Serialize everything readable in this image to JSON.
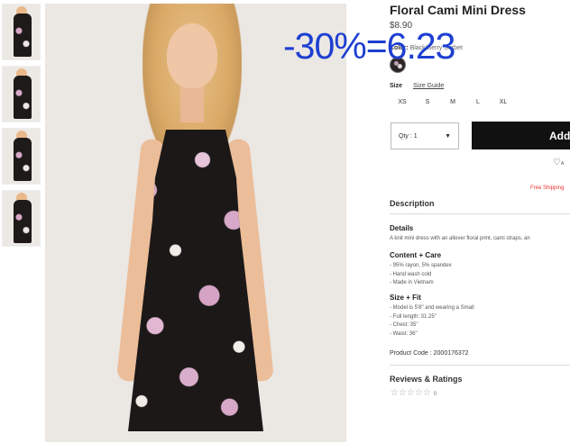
{
  "overlay": {
    "text": "-30%=6.23"
  },
  "product": {
    "title": "Floral Cami Mini Dress",
    "price": "$8.90",
    "color_label": "Color:",
    "color_value": "Black/Berry Sorbet",
    "size_label": "Size",
    "size_guide": "Size Guide",
    "sizes": [
      "XS",
      "S",
      "M",
      "L",
      "XL"
    ]
  },
  "purchase": {
    "qty_label": "Qty : 1",
    "add_button": "Add",
    "wishlist_icon": "heart-icon",
    "wishlist_label": "A",
    "free_shipping": "Free Shipping"
  },
  "description": {
    "heading": "Description",
    "details_heading": "Details",
    "details_text": "A knit mini dress with an allover floral print, cami straps, an",
    "content_heading": "Content + Care",
    "content_lines": [
      "- 95% rayon, 5% spandex",
      "- Hand wash cold",
      "- Made in Vietnam"
    ],
    "fit_heading": "Size + Fit",
    "fit_lines": [
      "- Model is 5'8\" and wearing a Small",
      "- Full length: 31.25\"",
      "- Chest: 35\"",
      "- Waist: 36\""
    ],
    "product_code": "Product Code : 2000176372"
  },
  "reviews": {
    "heading": "Reviews & Ratings",
    "stars": "☆☆☆☆☆",
    "count": "0"
  },
  "colors": {
    "overlay_blue": "#1d3fd1",
    "button_black": "#111111",
    "shipping_red": "#ee3333"
  }
}
